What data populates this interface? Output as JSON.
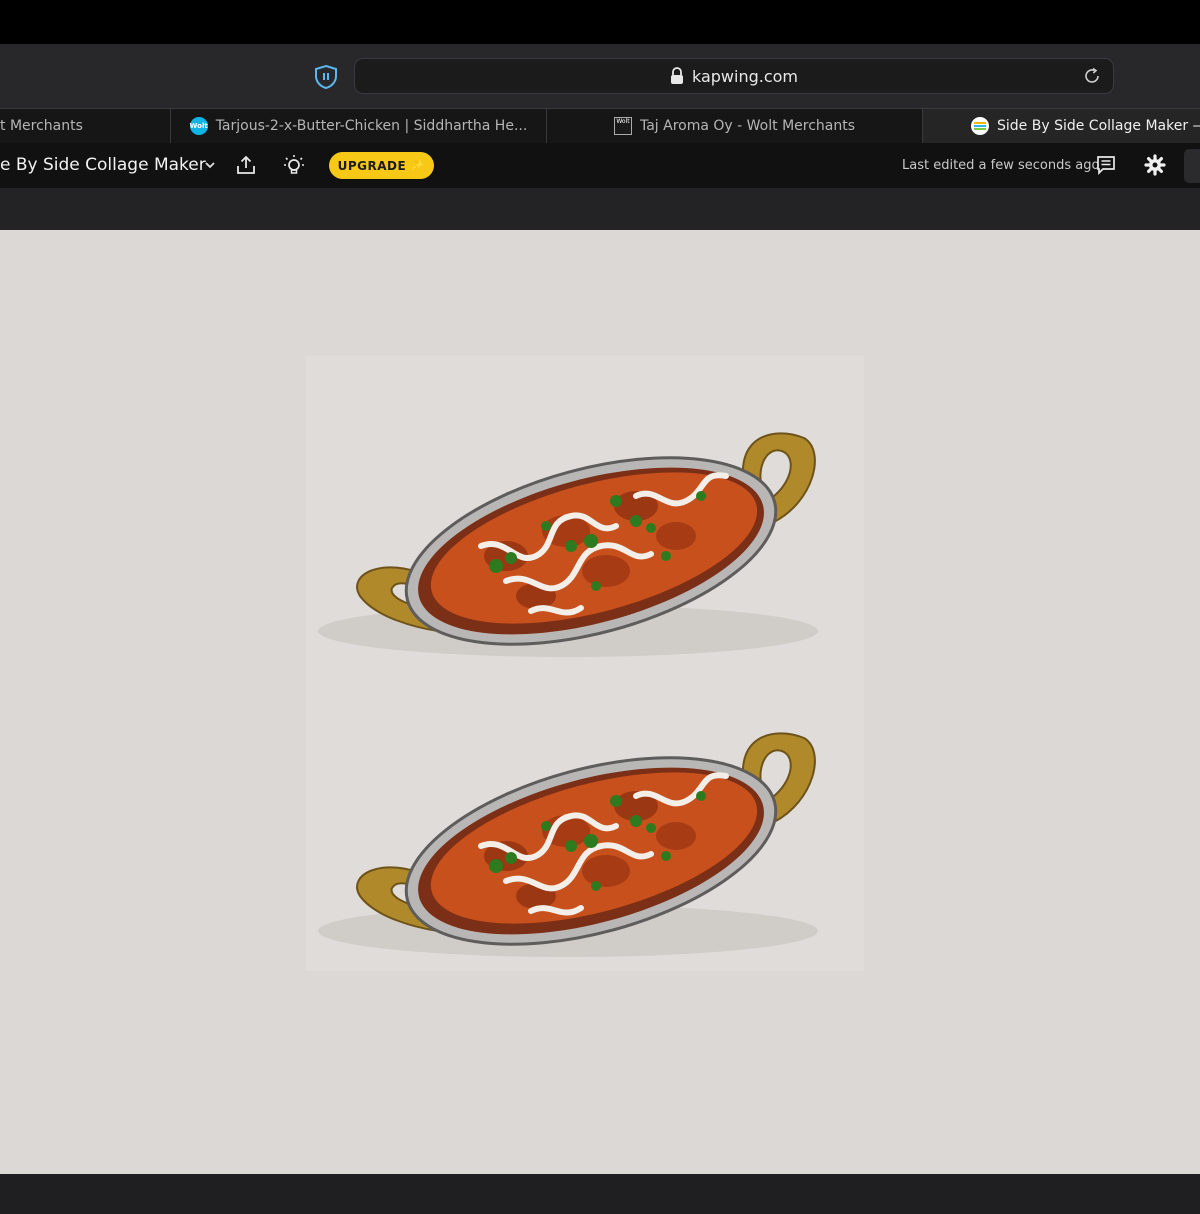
{
  "browser": {
    "url": "kapwing.com",
    "tabs": [
      {
        "label": "t Merchants",
        "favicon": "none",
        "active": false
      },
      {
        "label": "Tarjous-2-x-Butter-Chicken | Siddhartha He...",
        "favicon": "wolt-icon",
        "active": false
      },
      {
        "label": "Taj Aroma Oy - Wolt Merchants",
        "favicon": "wolt-square-icon",
        "active": false
      },
      {
        "label": "Side By Side Collage Maker — K",
        "favicon": "kapwing-icon",
        "active": true
      }
    ],
    "favicon_text": {
      "wolt": "Wolt",
      "taj": "Wolt"
    }
  },
  "app": {
    "project_title": "e By Side Collage Maker",
    "upgrade_label": "UPGRADE",
    "last_edited": "Last edited a few seconds ago"
  },
  "colors": {
    "upgrade": "#f7c815",
    "canvas_bg": "#dcd8d5",
    "wolt": "#10b5e6",
    "curry": "#c8501c"
  }
}
